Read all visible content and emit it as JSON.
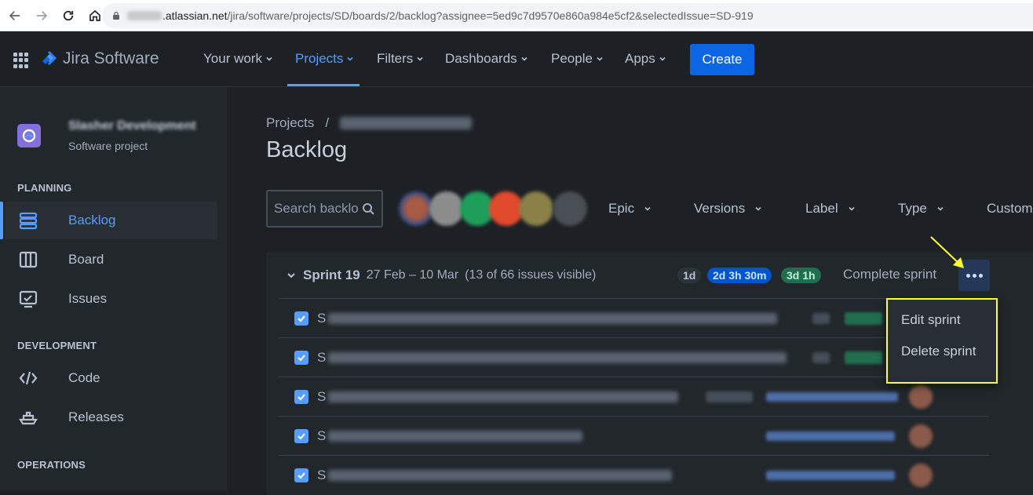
{
  "browser": {
    "url_host": ".atlassian.net",
    "url_path": "/jira/software/projects/SD/boards/2/backlog?assignee=5ed9c7d9570e860a984e5cf2&selectedIssue=SD-919"
  },
  "topnav": {
    "logo": "Jira Software",
    "items": [
      "Your work",
      "Projects",
      "Filters",
      "Dashboards",
      "People",
      "Apps"
    ],
    "active": "Projects",
    "create_label": "Create"
  },
  "sidebar": {
    "project_name": "Slasher Development",
    "project_type": "Software project",
    "sections": {
      "planning": "PLANNING",
      "development": "DEVELOPMENT",
      "operations": "OPERATIONS"
    },
    "items": {
      "backlog": "Backlog",
      "board": "Board",
      "issues": "Issues",
      "code": "Code",
      "releases": "Releases"
    }
  },
  "main": {
    "breadcrumb_root": "Projects",
    "breadcrumb_sep": "/",
    "breadcrumb_project": "Slasher Development",
    "title": "Backlog",
    "search_placeholder": "Search backlog",
    "filters": [
      "Epic",
      "Versions",
      "Label",
      "Type",
      "Custom"
    ]
  },
  "sprint": {
    "name": "Sprint 19",
    "dates": "27 Feb – 10 Mar",
    "count": "(13 of 66 issues visible)",
    "badge_todo": "1d",
    "badge_inprogress": "2d 3h 30m",
    "badge_done": "3d 1h",
    "complete_label": "Complete sprint",
    "issues": [
      {
        "key": "S"
      },
      {
        "key": "S"
      },
      {
        "key": "S"
      },
      {
        "key": "S"
      },
      {
        "key": "S"
      }
    ]
  },
  "menu": {
    "edit": "Edit sprint",
    "delete": "Delete sprint"
  },
  "colors": {
    "accent": "#579dff",
    "create": "#0c66e4",
    "highlight": "#ffff33"
  }
}
